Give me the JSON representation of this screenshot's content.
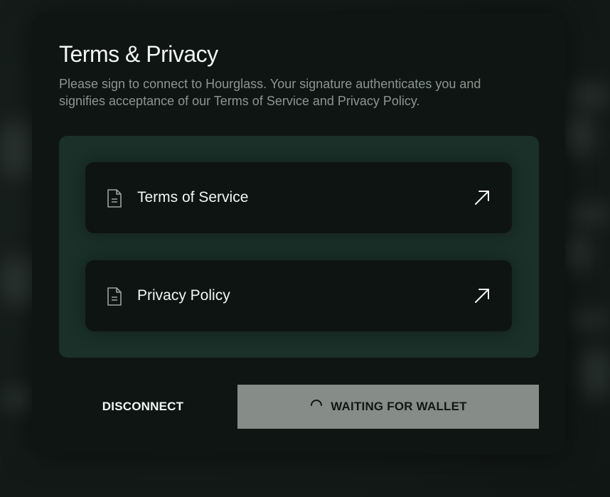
{
  "modal": {
    "title": "Terms & Privacy",
    "subtitle": "Please sign to connect to Hourglass. Your signature authenticates you and signifies acceptance of our Terms of Service and Privacy Policy."
  },
  "links": [
    {
      "label": "Terms of Service",
      "icon": "document-icon",
      "action_icon": "external-link-arrow-icon"
    },
    {
      "label": "Privacy Policy",
      "icon": "document-icon",
      "action_icon": "external-link-arrow-icon"
    }
  ],
  "actions": {
    "disconnect_label": "DISCONNECT",
    "waiting_label": "WAITING FOR WALLET",
    "waiting_icon": "spinner-icon"
  },
  "colors": {
    "modal_background": "#0f1513",
    "panel_background": "#1b3029",
    "card_background": "#0e1412",
    "waiting_button": "#868d89",
    "text_primary": "#f2f5f3",
    "text_secondary": "#8a9690"
  }
}
